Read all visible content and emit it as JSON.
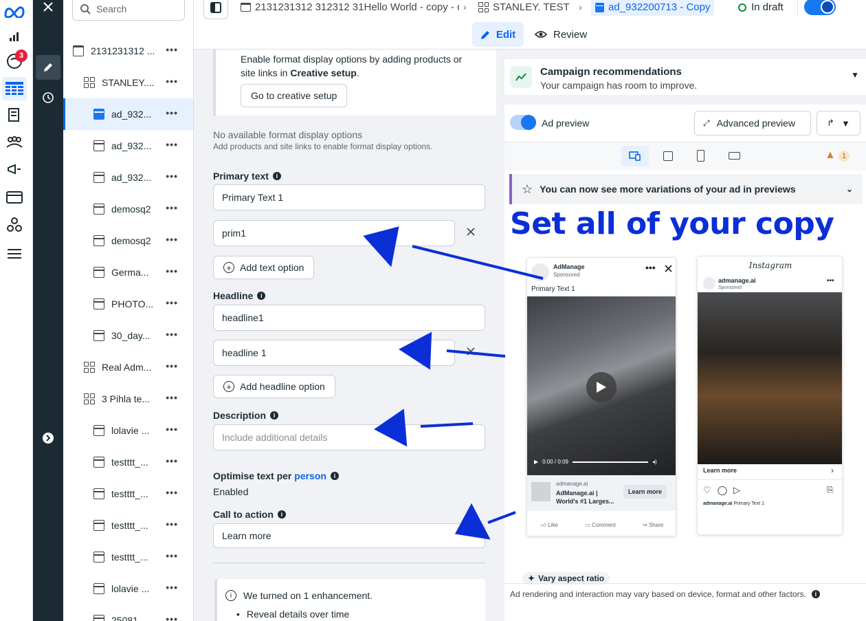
{
  "rail": {
    "notif_count": "3"
  },
  "tree": {
    "search_placeholder": "Search",
    "items": [
      {
        "label": "2131231312 ...",
        "icon": "folder-icon"
      },
      {
        "label": "STANLEY....",
        "icon": "adset-icon"
      },
      {
        "label": "ad_932...",
        "icon": "ad-icon"
      },
      {
        "label": "ad_932...",
        "icon": "ad-icon"
      },
      {
        "label": "ad_932...",
        "icon": "ad-icon"
      },
      {
        "label": "demosq2",
        "icon": "ad-icon"
      },
      {
        "label": "demosq2",
        "icon": "ad-icon"
      },
      {
        "label": "Germa...",
        "icon": "ad-icon"
      },
      {
        "label": "PHOTO...",
        "icon": "ad-icon"
      },
      {
        "label": "30_day...",
        "icon": "ad-icon"
      },
      {
        "label": "Real Adm...",
        "icon": "adset-icon"
      },
      {
        "label": "3 Pihla te...",
        "icon": "adset-icon"
      },
      {
        "label": "lolavie ...",
        "icon": "ad-icon"
      },
      {
        "label": "testttt_...",
        "icon": "ad-icon"
      },
      {
        "label": "testttt_...",
        "icon": "ad-icon"
      },
      {
        "label": "testttt_...",
        "icon": "ad-icon"
      },
      {
        "label": "testttt_...",
        "icon": "ad-icon"
      },
      {
        "label": "lolavie ...",
        "icon": "ad-icon"
      },
      {
        "label": "25081...",
        "icon": "ad-icon"
      }
    ]
  },
  "topbar": {
    "crumb1": "2131231312 312312 31Hello World - copy - c",
    "crumb2": "STANLEY. TEST",
    "crumb3": "ad_932200713 - Copy",
    "status": "In draft",
    "edit_label": "Edit",
    "review_label": "Review"
  },
  "form": {
    "creative_note_1": "Enable format display options by adding products or",
    "creative_note_2a": "site links in ",
    "creative_note_2b": "Creative setup",
    "creative_note_2c": ".",
    "creative_button": "Go to creative setup",
    "no_options_title": "No available format display options",
    "no_options_sub": "Add products and site links to enable format display options.",
    "primary_text_label": "Primary text",
    "primary_text_1": "Primary Text 1",
    "primary_text_2": "prim1",
    "add_text_option": "Add text option",
    "headline_label": "Headline",
    "headline_1": "headline1",
    "headline_2": "headline 1",
    "add_headline_option": "Add headline option",
    "description_label": "Description",
    "description_placeholder": "Include additional details",
    "optimise_label_a": "Optimise text per ",
    "optimise_label_b": "person",
    "optimise_value": "Enabled",
    "cta_label": "Call to action",
    "cta_value": "Learn more",
    "enhancement_note": "We turned on 1 enhancement.",
    "enhancement_bullet": "Reveal details over time"
  },
  "preview": {
    "rec_title": "Campaign recommendations",
    "rec_sub": "Your campaign has room to improve.",
    "ad_preview_label": "Ad preview",
    "advanced_preview": "Advanced preview",
    "warning_count": "1",
    "variations_banner": "You can now see more variations of your ad in previews",
    "overlay_text": "Set all of your copy",
    "fb": {
      "page_name": "AdManage",
      "sponsored": "Sponsored",
      "primary_text": "Primary Text 1",
      "time": "0:00 / 0:09",
      "domain": "admanage.ai",
      "headline": "AdManage.ai | World's #1 Larges...",
      "cta": "Learn more",
      "like": "Like",
      "comment": "Comment",
      "share": "Share"
    },
    "ig": {
      "logo": "Instagram",
      "account": "admanage.ai",
      "sponsored": "Sponsored",
      "cta": "Learn more",
      "caption_account": "admanage.ai",
      "caption_text": "Primary Text 1"
    },
    "vary_aspect": "Vary aspect ratio",
    "footer_note": "Ad rendering and interaction may vary based on device, format and other factors."
  },
  "colors": {
    "accent": "#0a66ea",
    "annotation": "#0b2fd6",
    "dark_rail": "#1c2b33"
  }
}
